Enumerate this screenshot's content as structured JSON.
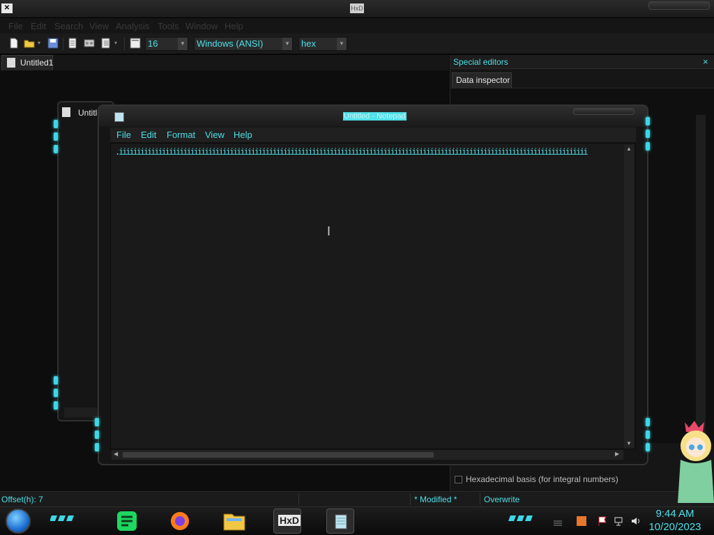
{
  "hxd": {
    "title": "HxD",
    "menu": [
      "File",
      "Edit",
      "Search",
      "View",
      "Analysis",
      "Tools",
      "Window",
      "Help"
    ],
    "toolbar": {
      "bytes_per_row": "16",
      "charset": "Windows (ANSI)",
      "offset_base": "hex"
    },
    "tab": "Untitled1",
    "special_editors": {
      "title": "Special editors",
      "close": "×",
      "tab": "Data inspector",
      "hex_basis_label": "Hexadecimal basis (for integral numbers)"
    },
    "status": {
      "offset": "Offset(h): 7",
      "modified": "* Modified *",
      "mode": "Overwrite"
    }
  },
  "background_window": {
    "title": "Untitle"
  },
  "notepad": {
    "title": "Untitled - Notepad",
    "menu": [
      "File",
      "Edit",
      "Format",
      "View",
      "Help"
    ],
    "content": ".iiiiiiiiiiiiiiiiiiiiiiiiiiiiiiiiiiiiiiiiiiiiiiiiiiiiiiiiiiiiiiiiiiiiiiiiiiiiiiiiiiiiiiiiiiiiiiiiiiiiiiiiiiiiiiiiiiiiiiiiiiiiiiiiiii"
  },
  "taskbar": {
    "time": "9:44 AM",
    "date": "10/20/2023"
  },
  "colors": {
    "accent": "#4ee0e8",
    "background": "#0c0c0c",
    "panel": "#161616"
  }
}
